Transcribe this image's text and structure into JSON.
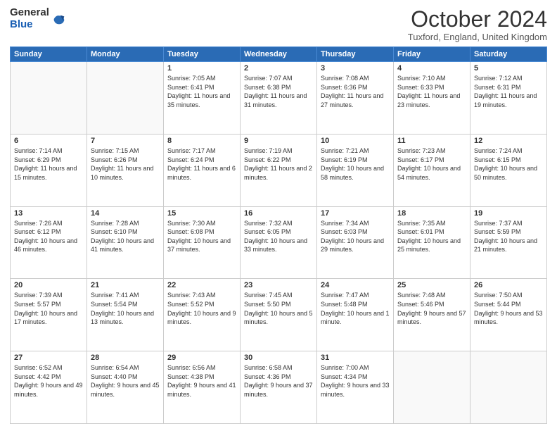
{
  "header": {
    "logo_line1": "General",
    "logo_line2": "Blue",
    "month_title": "October 2024",
    "location": "Tuxford, England, United Kingdom"
  },
  "days_of_week": [
    "Sunday",
    "Monday",
    "Tuesday",
    "Wednesday",
    "Thursday",
    "Friday",
    "Saturday"
  ],
  "weeks": [
    [
      {
        "day": "",
        "sunrise": "",
        "sunset": "",
        "daylight": ""
      },
      {
        "day": "",
        "sunrise": "",
        "sunset": "",
        "daylight": ""
      },
      {
        "day": "1",
        "sunrise": "Sunrise: 7:05 AM",
        "sunset": "Sunset: 6:41 PM",
        "daylight": "Daylight: 11 hours and 35 minutes."
      },
      {
        "day": "2",
        "sunrise": "Sunrise: 7:07 AM",
        "sunset": "Sunset: 6:38 PM",
        "daylight": "Daylight: 11 hours and 31 minutes."
      },
      {
        "day": "3",
        "sunrise": "Sunrise: 7:08 AM",
        "sunset": "Sunset: 6:36 PM",
        "daylight": "Daylight: 11 hours and 27 minutes."
      },
      {
        "day": "4",
        "sunrise": "Sunrise: 7:10 AM",
        "sunset": "Sunset: 6:33 PM",
        "daylight": "Daylight: 11 hours and 23 minutes."
      },
      {
        "day": "5",
        "sunrise": "Sunrise: 7:12 AM",
        "sunset": "Sunset: 6:31 PM",
        "daylight": "Daylight: 11 hours and 19 minutes."
      }
    ],
    [
      {
        "day": "6",
        "sunrise": "Sunrise: 7:14 AM",
        "sunset": "Sunset: 6:29 PM",
        "daylight": "Daylight: 11 hours and 15 minutes."
      },
      {
        "day": "7",
        "sunrise": "Sunrise: 7:15 AM",
        "sunset": "Sunset: 6:26 PM",
        "daylight": "Daylight: 11 hours and 10 minutes."
      },
      {
        "day": "8",
        "sunrise": "Sunrise: 7:17 AM",
        "sunset": "Sunset: 6:24 PM",
        "daylight": "Daylight: 11 hours and 6 minutes."
      },
      {
        "day": "9",
        "sunrise": "Sunrise: 7:19 AM",
        "sunset": "Sunset: 6:22 PM",
        "daylight": "Daylight: 11 hours and 2 minutes."
      },
      {
        "day": "10",
        "sunrise": "Sunrise: 7:21 AM",
        "sunset": "Sunset: 6:19 PM",
        "daylight": "Daylight: 10 hours and 58 minutes."
      },
      {
        "day": "11",
        "sunrise": "Sunrise: 7:23 AM",
        "sunset": "Sunset: 6:17 PM",
        "daylight": "Daylight: 10 hours and 54 minutes."
      },
      {
        "day": "12",
        "sunrise": "Sunrise: 7:24 AM",
        "sunset": "Sunset: 6:15 PM",
        "daylight": "Daylight: 10 hours and 50 minutes."
      }
    ],
    [
      {
        "day": "13",
        "sunrise": "Sunrise: 7:26 AM",
        "sunset": "Sunset: 6:12 PM",
        "daylight": "Daylight: 10 hours and 46 minutes."
      },
      {
        "day": "14",
        "sunrise": "Sunrise: 7:28 AM",
        "sunset": "Sunset: 6:10 PM",
        "daylight": "Daylight: 10 hours and 41 minutes."
      },
      {
        "day": "15",
        "sunrise": "Sunrise: 7:30 AM",
        "sunset": "Sunset: 6:08 PM",
        "daylight": "Daylight: 10 hours and 37 minutes."
      },
      {
        "day": "16",
        "sunrise": "Sunrise: 7:32 AM",
        "sunset": "Sunset: 6:05 PM",
        "daylight": "Daylight: 10 hours and 33 minutes."
      },
      {
        "day": "17",
        "sunrise": "Sunrise: 7:34 AM",
        "sunset": "Sunset: 6:03 PM",
        "daylight": "Daylight: 10 hours and 29 minutes."
      },
      {
        "day": "18",
        "sunrise": "Sunrise: 7:35 AM",
        "sunset": "Sunset: 6:01 PM",
        "daylight": "Daylight: 10 hours and 25 minutes."
      },
      {
        "day": "19",
        "sunrise": "Sunrise: 7:37 AM",
        "sunset": "Sunset: 5:59 PM",
        "daylight": "Daylight: 10 hours and 21 minutes."
      }
    ],
    [
      {
        "day": "20",
        "sunrise": "Sunrise: 7:39 AM",
        "sunset": "Sunset: 5:57 PM",
        "daylight": "Daylight: 10 hours and 17 minutes."
      },
      {
        "day": "21",
        "sunrise": "Sunrise: 7:41 AM",
        "sunset": "Sunset: 5:54 PM",
        "daylight": "Daylight: 10 hours and 13 minutes."
      },
      {
        "day": "22",
        "sunrise": "Sunrise: 7:43 AM",
        "sunset": "Sunset: 5:52 PM",
        "daylight": "Daylight: 10 hours and 9 minutes."
      },
      {
        "day": "23",
        "sunrise": "Sunrise: 7:45 AM",
        "sunset": "Sunset: 5:50 PM",
        "daylight": "Daylight: 10 hours and 5 minutes."
      },
      {
        "day": "24",
        "sunrise": "Sunrise: 7:47 AM",
        "sunset": "Sunset: 5:48 PM",
        "daylight": "Daylight: 10 hours and 1 minute."
      },
      {
        "day": "25",
        "sunrise": "Sunrise: 7:48 AM",
        "sunset": "Sunset: 5:46 PM",
        "daylight": "Daylight: 9 hours and 57 minutes."
      },
      {
        "day": "26",
        "sunrise": "Sunrise: 7:50 AM",
        "sunset": "Sunset: 5:44 PM",
        "daylight": "Daylight: 9 hours and 53 minutes."
      }
    ],
    [
      {
        "day": "27",
        "sunrise": "Sunrise: 6:52 AM",
        "sunset": "Sunset: 4:42 PM",
        "daylight": "Daylight: 9 hours and 49 minutes."
      },
      {
        "day": "28",
        "sunrise": "Sunrise: 6:54 AM",
        "sunset": "Sunset: 4:40 PM",
        "daylight": "Daylight: 9 hours and 45 minutes."
      },
      {
        "day": "29",
        "sunrise": "Sunrise: 6:56 AM",
        "sunset": "Sunset: 4:38 PM",
        "daylight": "Daylight: 9 hours and 41 minutes."
      },
      {
        "day": "30",
        "sunrise": "Sunrise: 6:58 AM",
        "sunset": "Sunset: 4:36 PM",
        "daylight": "Daylight: 9 hours and 37 minutes."
      },
      {
        "day": "31",
        "sunrise": "Sunrise: 7:00 AM",
        "sunset": "Sunset: 4:34 PM",
        "daylight": "Daylight: 9 hours and 33 minutes."
      },
      {
        "day": "",
        "sunrise": "",
        "sunset": "",
        "daylight": ""
      },
      {
        "day": "",
        "sunrise": "",
        "sunset": "",
        "daylight": ""
      }
    ]
  ]
}
